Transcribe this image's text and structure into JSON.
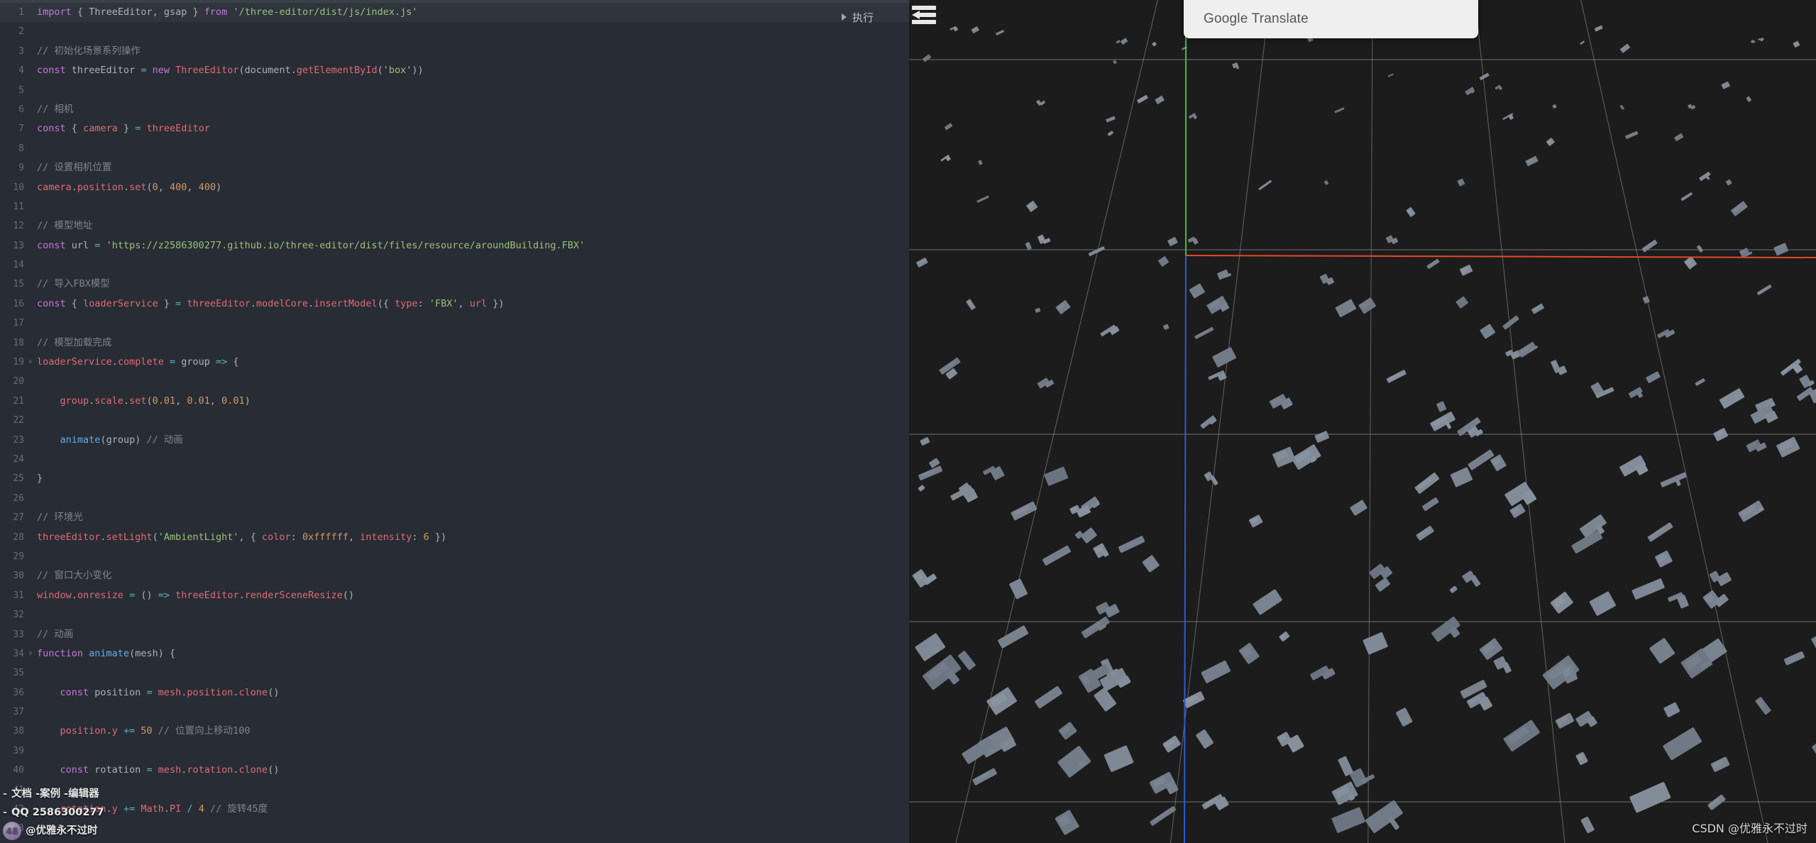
{
  "editor": {
    "run_button": {
      "label": "执行",
      "icon": "play-triangle-icon"
    },
    "collapse_icon": "collapse-sidebar-icon",
    "active_line": 1,
    "lines": [
      {
        "n": 1,
        "fold": "",
        "tokens": [
          {
            "t": "import",
            "c": "kw"
          },
          {
            "t": " ",
            "c": "plain"
          },
          {
            "t": "{",
            "c": "punc"
          },
          {
            "t": " ThreeEditor, gsap ",
            "c": "plain"
          },
          {
            "t": "}",
            "c": "punc"
          },
          {
            "t": " ",
            "c": "plain"
          },
          {
            "t": "from",
            "c": "kw"
          },
          {
            "t": " ",
            "c": "plain"
          },
          {
            "t": "'/three-editor/dist/js/index.js'",
            "c": "str"
          }
        ]
      },
      {
        "n": 2,
        "fold": "",
        "tokens": []
      },
      {
        "n": 3,
        "fold": "",
        "tokens": [
          {
            "t": "// 初始化场景系列操作",
            "c": "cmt"
          }
        ]
      },
      {
        "n": 4,
        "fold": "",
        "tokens": [
          {
            "t": "const",
            "c": "kw"
          },
          {
            "t": " threeEditor ",
            "c": "plain"
          },
          {
            "t": "=",
            "c": "op"
          },
          {
            "t": " ",
            "c": "plain"
          },
          {
            "t": "new",
            "c": "kw"
          },
          {
            "t": " ",
            "c": "plain"
          },
          {
            "t": "ThreeEditor",
            "c": "var"
          },
          {
            "t": "(",
            "c": "punc"
          },
          {
            "t": "document",
            "c": "plain"
          },
          {
            "t": ".",
            "c": "punc"
          },
          {
            "t": "getElementById",
            "c": "var"
          },
          {
            "t": "(",
            "c": "punc"
          },
          {
            "t": "'box'",
            "c": "str"
          },
          {
            "t": "))",
            "c": "punc"
          }
        ]
      },
      {
        "n": 5,
        "fold": "",
        "tokens": []
      },
      {
        "n": 6,
        "fold": "",
        "tokens": [
          {
            "t": "// 相机",
            "c": "cmt"
          }
        ]
      },
      {
        "n": 7,
        "fold": "",
        "tokens": [
          {
            "t": "const",
            "c": "kw"
          },
          {
            "t": " ",
            "c": "plain"
          },
          {
            "t": "{",
            "c": "punc"
          },
          {
            "t": " ",
            "c": "plain"
          },
          {
            "t": "camera",
            "c": "var"
          },
          {
            "t": " ",
            "c": "plain"
          },
          {
            "t": "}",
            "c": "punc"
          },
          {
            "t": " ",
            "c": "plain"
          },
          {
            "t": "=",
            "c": "op"
          },
          {
            "t": " ",
            "c": "plain"
          },
          {
            "t": "threeEditor",
            "c": "var"
          }
        ]
      },
      {
        "n": 8,
        "fold": "",
        "tokens": []
      },
      {
        "n": 9,
        "fold": "",
        "tokens": [
          {
            "t": "// 设置相机位置",
            "c": "cmt"
          }
        ]
      },
      {
        "n": 10,
        "fold": "",
        "tokens": [
          {
            "t": "camera",
            "c": "var"
          },
          {
            "t": ".",
            "c": "punc"
          },
          {
            "t": "position",
            "c": "var"
          },
          {
            "t": ".",
            "c": "punc"
          },
          {
            "t": "set",
            "c": "var"
          },
          {
            "t": "(",
            "c": "punc"
          },
          {
            "t": "0",
            "c": "num"
          },
          {
            "t": ", ",
            "c": "punc"
          },
          {
            "t": "400",
            "c": "num"
          },
          {
            "t": ", ",
            "c": "punc"
          },
          {
            "t": "400",
            "c": "num"
          },
          {
            "t": ")",
            "c": "punc"
          }
        ]
      },
      {
        "n": 11,
        "fold": "",
        "tokens": []
      },
      {
        "n": 12,
        "fold": "",
        "tokens": [
          {
            "t": "// 模型地址",
            "c": "cmt"
          }
        ]
      },
      {
        "n": 13,
        "fold": "",
        "tokens": [
          {
            "t": "const",
            "c": "kw"
          },
          {
            "t": " url ",
            "c": "plain"
          },
          {
            "t": "=",
            "c": "op"
          },
          {
            "t": " ",
            "c": "plain"
          },
          {
            "t": "'https://z2586300277.github.io/three-editor/dist/files/resource/aroundBuilding.FBX'",
            "c": "str"
          }
        ]
      },
      {
        "n": 14,
        "fold": "",
        "tokens": []
      },
      {
        "n": 15,
        "fold": "",
        "tokens": [
          {
            "t": "// 导入FBX模型",
            "c": "cmt"
          }
        ]
      },
      {
        "n": 16,
        "fold": "",
        "tokens": [
          {
            "t": "const",
            "c": "kw"
          },
          {
            "t": " ",
            "c": "plain"
          },
          {
            "t": "{",
            "c": "punc"
          },
          {
            "t": " ",
            "c": "plain"
          },
          {
            "t": "loaderService",
            "c": "var"
          },
          {
            "t": " ",
            "c": "plain"
          },
          {
            "t": "}",
            "c": "punc"
          },
          {
            "t": " ",
            "c": "plain"
          },
          {
            "t": "=",
            "c": "op"
          },
          {
            "t": " ",
            "c": "plain"
          },
          {
            "t": "threeEditor",
            "c": "var"
          },
          {
            "t": ".",
            "c": "punc"
          },
          {
            "t": "modelCore",
            "c": "var"
          },
          {
            "t": ".",
            "c": "punc"
          },
          {
            "t": "insertModel",
            "c": "var"
          },
          {
            "t": "({ ",
            "c": "punc"
          },
          {
            "t": "type",
            "c": "var"
          },
          {
            "t": ": ",
            "c": "punc"
          },
          {
            "t": "'FBX'",
            "c": "str"
          },
          {
            "t": ", ",
            "c": "punc"
          },
          {
            "t": "url",
            "c": "var"
          },
          {
            "t": " })",
            "c": "punc"
          }
        ]
      },
      {
        "n": 17,
        "fold": "",
        "tokens": []
      },
      {
        "n": 18,
        "fold": "",
        "tokens": [
          {
            "t": "// 模型加载完成",
            "c": "cmt"
          }
        ]
      },
      {
        "n": 19,
        "fold": "v",
        "tokens": [
          {
            "t": "loaderService",
            "c": "var"
          },
          {
            "t": ".",
            "c": "punc"
          },
          {
            "t": "complete",
            "c": "var"
          },
          {
            "t": " ",
            "c": "plain"
          },
          {
            "t": "=",
            "c": "op"
          },
          {
            "t": " group ",
            "c": "plain"
          },
          {
            "t": "=>",
            "c": "op"
          },
          {
            "t": " {",
            "c": "punc"
          }
        ]
      },
      {
        "n": 20,
        "fold": "",
        "tokens": []
      },
      {
        "n": 21,
        "fold": "",
        "tokens": [
          {
            "t": "    ",
            "c": "plain"
          },
          {
            "t": "group",
            "c": "var"
          },
          {
            "t": ".",
            "c": "punc"
          },
          {
            "t": "scale",
            "c": "var"
          },
          {
            "t": ".",
            "c": "punc"
          },
          {
            "t": "set",
            "c": "var"
          },
          {
            "t": "(",
            "c": "punc"
          },
          {
            "t": "0.01",
            "c": "num"
          },
          {
            "t": ", ",
            "c": "punc"
          },
          {
            "t": "0.01",
            "c": "num"
          },
          {
            "t": ", ",
            "c": "punc"
          },
          {
            "t": "0.01",
            "c": "num"
          },
          {
            "t": ")",
            "c": "punc"
          }
        ]
      },
      {
        "n": 22,
        "fold": "",
        "tokens": []
      },
      {
        "n": 23,
        "fold": "",
        "tokens": [
          {
            "t": "    ",
            "c": "plain"
          },
          {
            "t": "animate",
            "c": "fn"
          },
          {
            "t": "(",
            "c": "punc"
          },
          {
            "t": "group",
            "c": "plain"
          },
          {
            "t": ") ",
            "c": "punc"
          },
          {
            "t": "// 动画",
            "c": "cmt"
          }
        ]
      },
      {
        "n": 24,
        "fold": "",
        "tokens": []
      },
      {
        "n": 25,
        "fold": "",
        "tokens": [
          {
            "t": "}",
            "c": "punc"
          }
        ]
      },
      {
        "n": 26,
        "fold": "",
        "tokens": []
      },
      {
        "n": 27,
        "fold": "",
        "tokens": [
          {
            "t": "// 环境光",
            "c": "cmt"
          }
        ]
      },
      {
        "n": 28,
        "fold": "",
        "tokens": [
          {
            "t": "threeEditor",
            "c": "var"
          },
          {
            "t": ".",
            "c": "punc"
          },
          {
            "t": "setLight",
            "c": "var"
          },
          {
            "t": "(",
            "c": "punc"
          },
          {
            "t": "'AmbientLight'",
            "c": "str"
          },
          {
            "t": ", { ",
            "c": "punc"
          },
          {
            "t": "color",
            "c": "var"
          },
          {
            "t": ": ",
            "c": "punc"
          },
          {
            "t": "0xffffff",
            "c": "num"
          },
          {
            "t": ", ",
            "c": "punc"
          },
          {
            "t": "intensity",
            "c": "var"
          },
          {
            "t": ": ",
            "c": "punc"
          },
          {
            "t": "6",
            "c": "num"
          },
          {
            "t": " })",
            "c": "punc"
          }
        ]
      },
      {
        "n": 29,
        "fold": "",
        "tokens": []
      },
      {
        "n": 30,
        "fold": "",
        "tokens": [
          {
            "t": "// 窗口大小变化",
            "c": "cmt"
          }
        ]
      },
      {
        "n": 31,
        "fold": "",
        "tokens": [
          {
            "t": "window",
            "c": "var"
          },
          {
            "t": ".",
            "c": "punc"
          },
          {
            "t": "onresize",
            "c": "var"
          },
          {
            "t": " ",
            "c": "plain"
          },
          {
            "t": "=",
            "c": "op"
          },
          {
            "t": " ()",
            "c": "punc"
          },
          {
            "t": " ",
            "c": "plain"
          },
          {
            "t": "=>",
            "c": "op"
          },
          {
            "t": " ",
            "c": "plain"
          },
          {
            "t": "threeEditor",
            "c": "var"
          },
          {
            "t": ".",
            "c": "punc"
          },
          {
            "t": "renderSceneResize",
            "c": "var"
          },
          {
            "t": "()",
            "c": "punc"
          }
        ]
      },
      {
        "n": 32,
        "fold": "",
        "tokens": []
      },
      {
        "n": 33,
        "fold": "",
        "tokens": [
          {
            "t": "// 动画",
            "c": "cmt"
          }
        ]
      },
      {
        "n": 34,
        "fold": "v",
        "tokens": [
          {
            "t": "function",
            "c": "kw"
          },
          {
            "t": " ",
            "c": "plain"
          },
          {
            "t": "animate",
            "c": "fn"
          },
          {
            "t": "(",
            "c": "punc"
          },
          {
            "t": "mesh",
            "c": "plain"
          },
          {
            "t": ") {",
            "c": "punc"
          }
        ]
      },
      {
        "n": 35,
        "fold": "",
        "tokens": []
      },
      {
        "n": 36,
        "fold": "",
        "tokens": [
          {
            "t": "    ",
            "c": "plain"
          },
          {
            "t": "const",
            "c": "kw"
          },
          {
            "t": " position ",
            "c": "plain"
          },
          {
            "t": "=",
            "c": "op"
          },
          {
            "t": " ",
            "c": "plain"
          },
          {
            "t": "mesh",
            "c": "var"
          },
          {
            "t": ".",
            "c": "punc"
          },
          {
            "t": "position",
            "c": "var"
          },
          {
            "t": ".",
            "c": "punc"
          },
          {
            "t": "clone",
            "c": "var"
          },
          {
            "t": "()",
            "c": "punc"
          }
        ]
      },
      {
        "n": 37,
        "fold": "",
        "tokens": []
      },
      {
        "n": 38,
        "fold": "",
        "tokens": [
          {
            "t": "    ",
            "c": "plain"
          },
          {
            "t": "position",
            "c": "var"
          },
          {
            "t": ".",
            "c": "punc"
          },
          {
            "t": "y",
            "c": "var"
          },
          {
            "t": " ",
            "c": "plain"
          },
          {
            "t": "+=",
            "c": "op"
          },
          {
            "t": " ",
            "c": "plain"
          },
          {
            "t": "50",
            "c": "num"
          },
          {
            "t": " ",
            "c": "plain"
          },
          {
            "t": "// 位置向上移动100",
            "c": "cmt"
          }
        ]
      },
      {
        "n": 39,
        "fold": "",
        "tokens": []
      },
      {
        "n": 40,
        "fold": "",
        "tokens": [
          {
            "t": "    ",
            "c": "plain"
          },
          {
            "t": "const",
            "c": "kw"
          },
          {
            "t": " rotation ",
            "c": "plain"
          },
          {
            "t": "=",
            "c": "op"
          },
          {
            "t": " ",
            "c": "plain"
          },
          {
            "t": "mesh",
            "c": "var"
          },
          {
            "t": ".",
            "c": "punc"
          },
          {
            "t": "rotation",
            "c": "var"
          },
          {
            "t": ".",
            "c": "punc"
          },
          {
            "t": "clone",
            "c": "var"
          },
          {
            "t": "()",
            "c": "punc"
          }
        ]
      },
      {
        "n": 41,
        "fold": "",
        "tokens": []
      },
      {
        "n": 42,
        "fold": "",
        "tokens": [
          {
            "t": "    ",
            "c": "plain"
          },
          {
            "t": "rotation",
            "c": "var"
          },
          {
            "t": ".",
            "c": "punc"
          },
          {
            "t": "y",
            "c": "var"
          },
          {
            "t": " ",
            "c": "plain"
          },
          {
            "t": "+=",
            "c": "op"
          },
          {
            "t": " ",
            "c": "plain"
          },
          {
            "t": "Math",
            "c": "var"
          },
          {
            "t": ".",
            "c": "punc"
          },
          {
            "t": "PI",
            "c": "var"
          },
          {
            "t": " ",
            "c": "plain"
          },
          {
            "t": "/",
            "c": "op"
          },
          {
            "t": " ",
            "c": "plain"
          },
          {
            "t": "4",
            "c": "num"
          },
          {
            "t": " ",
            "c": "plain"
          },
          {
            "t": "// 旋转45度",
            "c": "cmt"
          }
        ]
      },
      {
        "n": 43,
        "fold": "",
        "tokens": []
      }
    ]
  },
  "translate_popup": {
    "title": "Google Translate"
  },
  "overlay": {
    "nav_line": "文档 -案例 -编辑器",
    "qq_line": "QQ 2586300277",
    "author_line": "@优雅永不过时",
    "avatar_label": "48"
  },
  "watermark": {
    "text": "CSDN @优雅永不过时"
  },
  "scene": {
    "background": "#1c1c1c",
    "building_color": "#7c8592",
    "grid_color": "#b9b9b9",
    "axis_x_color": "#e8472a",
    "axis_y_color": "#35c435",
    "axis_z_color": "#2a5bd7"
  }
}
